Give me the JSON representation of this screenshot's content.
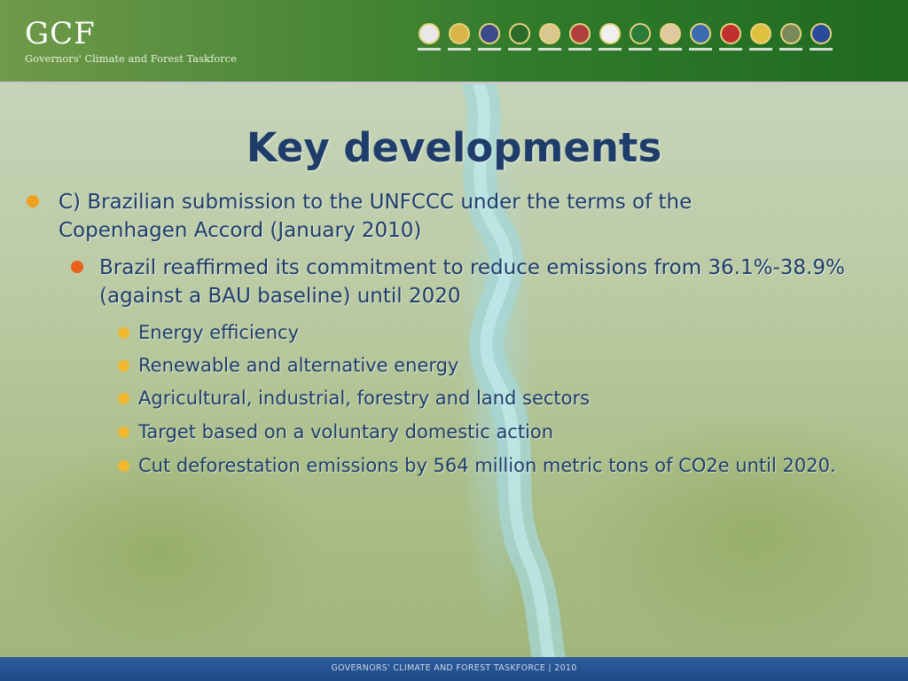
{
  "header": {
    "logo": "GCF",
    "logo_subtitle": "Governors' Climate and Forest Taskforce",
    "seals": [
      {
        "name": "seal-1",
        "color": "#e8e8e8"
      },
      {
        "name": "seal-2",
        "color": "#d9b54a"
      },
      {
        "name": "seal-3",
        "color": "#3a4a8a"
      },
      {
        "name": "seal-4",
        "color": "#2a6a2a"
      },
      {
        "name": "seal-5",
        "color": "#d8c890"
      },
      {
        "name": "seal-6",
        "color": "#b04040"
      },
      {
        "name": "seal-7",
        "color": "#f0f0f0"
      },
      {
        "name": "seal-8",
        "color": "#2a7a3a"
      },
      {
        "name": "seal-9",
        "color": "#e0c8a0"
      },
      {
        "name": "seal-10",
        "color": "#3a6ab0"
      },
      {
        "name": "seal-11",
        "color": "#c03030"
      },
      {
        "name": "seal-12",
        "color": "#e0c040"
      },
      {
        "name": "seal-13",
        "color": "#7a8a5a"
      },
      {
        "name": "seal-14",
        "color": "#2a4a9a"
      }
    ]
  },
  "slide": {
    "title": "Key developments",
    "level1": "C) Brazilian submission to the UNFCCC under the terms of the Copenhagen Accord (January 2010)",
    "level2": "Brazil reaffirmed its commitment to reduce emissions from 36.1%-38.9% (against a BAU baseline) until 2020",
    "level3": [
      "Energy efficiency",
      "Renewable and alternative energy",
      "Agricultural, industrial, forestry and land sectors",
      "Target based on a voluntary domestic action",
      "Cut deforestation emissions by 564 million metric tons of CO2e until 2020."
    ]
  },
  "footer": {
    "text": "GOVERNORS' CLIMATE AND FOREST TASKFORCE  |  2010"
  },
  "colors": {
    "title": "#1f3d6b",
    "bullet_level1": "#f0a020",
    "bullet_level2": "#e86018",
    "bullet_level3": "#f0b830",
    "header_green": "#2f7a2a",
    "footer_blue": "#1f4a88"
  }
}
